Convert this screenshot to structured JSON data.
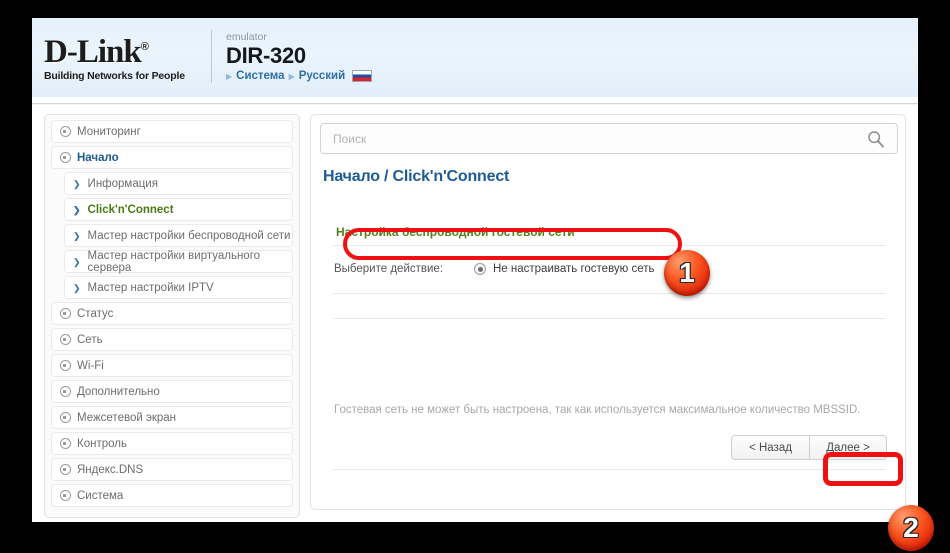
{
  "header": {
    "logo_main": "D-Link",
    "logo_reg": "®",
    "logo_tagline": "Building Networks for People",
    "emulator_label": "emulator",
    "model": "DIR-320",
    "nav_system": "Система",
    "nav_language": "Русский",
    "flag_name": "russian-flag"
  },
  "sidebar": {
    "items": [
      {
        "label": "Мониторинг",
        "type": "top",
        "state": "normal"
      },
      {
        "label": "Начало",
        "type": "top",
        "state": "open"
      },
      {
        "label": "Информация",
        "type": "sub",
        "state": "normal"
      },
      {
        "label": "Click'n'Connect",
        "type": "sub",
        "state": "active"
      },
      {
        "label": "Мастер настройки беспроводной сети",
        "type": "sub",
        "state": "normal"
      },
      {
        "label": "Мастер настройки виртуального сервера",
        "type": "sub",
        "state": "normal"
      },
      {
        "label": "Мастер настройки IPTV",
        "type": "sub",
        "state": "normal"
      },
      {
        "label": "Статус",
        "type": "top",
        "state": "normal"
      },
      {
        "label": "Сеть",
        "type": "top",
        "state": "normal"
      },
      {
        "label": "Wi-Fi",
        "type": "top",
        "state": "normal"
      },
      {
        "label": "Дополнительно",
        "type": "top",
        "state": "normal"
      },
      {
        "label": "Межсетевой экран",
        "type": "top",
        "state": "normal"
      },
      {
        "label": "Контроль",
        "type": "top",
        "state": "normal"
      },
      {
        "label": "Яндекс.DNS",
        "type": "top",
        "state": "normal"
      },
      {
        "label": "Система",
        "type": "top",
        "state": "normal"
      }
    ]
  },
  "search": {
    "placeholder": "Поиск",
    "value": "",
    "icon": "search-icon"
  },
  "main": {
    "breadcrumb_root": "Начало",
    "breadcrumb_sep": "/",
    "breadcrumb_current": "Click'n'Connect",
    "section_title": "Настройка беспроводной гостевой сети",
    "form_label": "Выберите действие:",
    "radio_label": "Не настраивать гостевую сеть",
    "radio_checked": true,
    "info_text": "Гостевая сеть не может быть настроена, так как используется максимальное количество MBSSID.",
    "btn_back": "< Назад",
    "btn_next": "Далее >"
  },
  "annotations": {
    "badge_one": "1",
    "badge_two": "2",
    "highlight_color": "#ee1111",
    "badge_color": "#e4250a"
  }
}
